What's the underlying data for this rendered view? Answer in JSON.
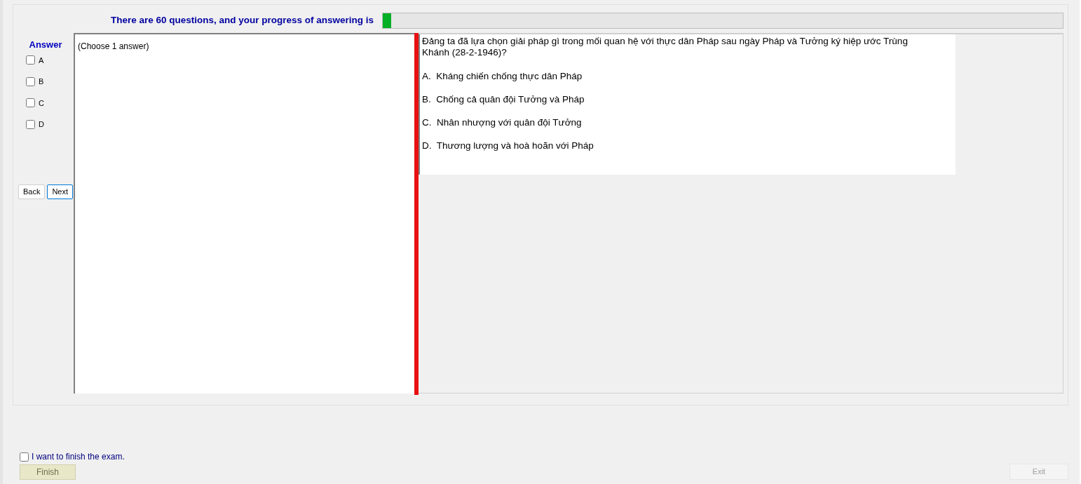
{
  "header": {
    "text": "There are 60 questions, and your progress of answering is",
    "progress": {
      "level": 0.012
    }
  },
  "answer_panel": {
    "title": "Answer",
    "options": [
      {
        "label": "A",
        "checked": false
      },
      {
        "label": "B",
        "checked": false
      },
      {
        "label": "C",
        "checked": false
      },
      {
        "label": "D",
        "checked": false
      }
    ],
    "buttons": [
      {
        "label": "Back",
        "selected": false
      },
      {
        "label": "Next",
        "selected": true
      }
    ]
  },
  "instruction": "(Choose 1 answer)",
  "question": {
    "text": "Đảng ta đã lựa chọn giải pháp gì trong mối quan hệ với thực dân Pháp sau ngày Pháp và Tưởng ký hiệp ước Trùng Khánh (28-2-1946)?",
    "choices": [
      "A.  Kháng chiến chống thực dân Pháp",
      "B.  Chống cả quân đội Tưởng và Pháp",
      "C.  Nhân nhượng với quân đội Tưởng",
      "D.  Thương lượng và hoà hoãn với Pháp"
    ]
  },
  "finish": {
    "label": "I want to finish the exam.",
    "checked": false,
    "button": "Finish"
  },
  "exit_button": {
    "label": "Exit",
    "disabled": true
  }
}
